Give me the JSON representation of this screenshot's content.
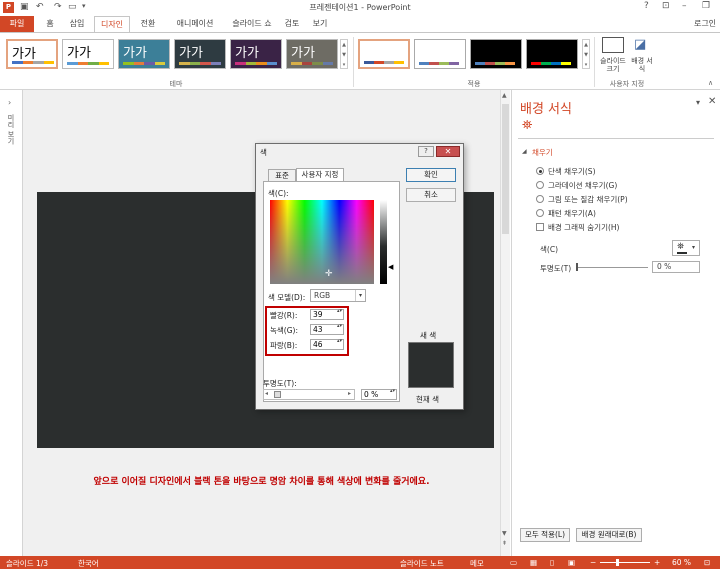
{
  "window": {
    "title": "프레젠테이션1 - PowerPoint",
    "help": "?",
    "login": "로그인"
  },
  "ribbon": {
    "tabs": [
      "파일",
      "홈",
      "삽입",
      "디자인",
      "전환",
      "애니메이션",
      "슬라이드 쇼",
      "검토",
      "보기"
    ],
    "themes": [
      {
        "label": "가가",
        "bg": "#ffffff",
        "fg": "#000000"
      },
      {
        "label": "가가",
        "bg": "#ffffff",
        "fg": "#000000"
      },
      {
        "label": "가가",
        "bg": "#3c7f98",
        "fg": "#ffffff"
      },
      {
        "label": "가가",
        "bg": "#2e3b41",
        "fg": "#ffffff"
      },
      {
        "label": "가가",
        "bg": "#3a2346",
        "fg": "#ffffff"
      },
      {
        "label": "가가",
        "bg": "#6e6c64",
        "fg": "#ffffff"
      }
    ],
    "group_theme": "테마",
    "group_variant": "적용",
    "slide_size": "슬라이드 크기",
    "bg_format": "배경 서식",
    "group_custom": "사용자 지정"
  },
  "left_strip": {
    "label": "미리 보기"
  },
  "slide": {
    "caption": "앞으로 이어질 디자인에서 블랙 톤을 바탕으로 명암 차이를 통해 색상에 변화를 줄거에요."
  },
  "pane": {
    "title": "배경 서식",
    "section": "채우기",
    "options": [
      "단색 채우기(S)",
      "그라데이션 채우기(G)",
      "그림 또는 질감 채우기(P)",
      "패턴 채우기(A)"
    ],
    "hide_bg": "배경 그래픽 숨기기(H)",
    "color_label": "색(C)",
    "transparency_label": "투명도(T)",
    "transparency_value": "0 %",
    "apply_all": "모두 적용(L)",
    "reset": "배경 원래대로(B)"
  },
  "dialog": {
    "title": "색",
    "tab_standard": "표준",
    "tab_custom": "사용자 지정",
    "ok": "확인",
    "cancel": "취소",
    "colors_label": "색(C):",
    "model_label": "색 모델(D):",
    "model_value": "RGB",
    "red_label": "빨강(R):",
    "red": "39",
    "green_label": "녹색(G):",
    "green": "43",
    "blue_label": "파랑(B):",
    "blue": "46",
    "new_label": "새 색",
    "current_label": "현재 색",
    "transparency_label": "투명도(T):",
    "transparency_value": "0 %"
  },
  "status": {
    "slide": "슬라이드 1/3",
    "lang": "한국어",
    "notes": "슬라이드 노트",
    "memo": "메모",
    "zoom": "60 %"
  },
  "colors": {
    "accent": "#d24726",
    "slide_bg": "#2b2e2e",
    "highlight": "#c00000"
  }
}
